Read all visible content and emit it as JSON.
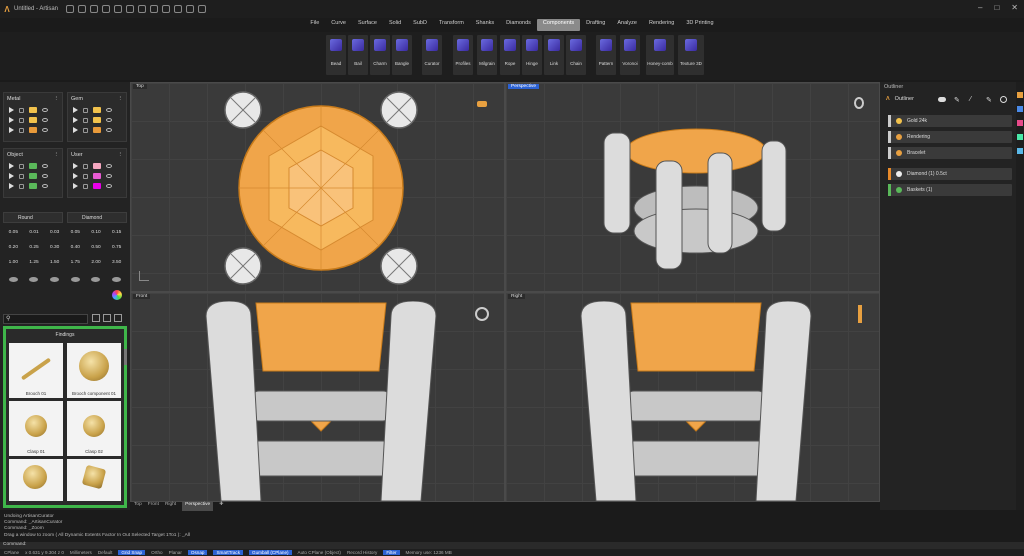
{
  "app": {
    "title": "Untitled - Artisan"
  },
  "menu_tabs": [
    "File",
    "Curve",
    "Surface",
    "Solid",
    "SubD",
    "Transform",
    "Shanks",
    "Diamonds",
    "Components",
    "Drafting",
    "Analyze",
    "Rendering",
    "3D Printing"
  ],
  "active_tab": "Components",
  "ribbon": [
    {
      "label": "Bead"
    },
    {
      "label": "Bail"
    },
    {
      "label": "Charm"
    },
    {
      "label": "Bangle"
    },
    {
      "label": "Curator"
    },
    {
      "label": "Profiles"
    },
    {
      "label": "Milgrain"
    },
    {
      "label": "Rope"
    },
    {
      "label": "Hinge"
    },
    {
      "label": "Link"
    },
    {
      "label": "Chain"
    },
    {
      "label": "Pattern"
    },
    {
      "label": "Voronoi"
    },
    {
      "label": "Honey-comb"
    },
    {
      "label": "Texture 3D"
    }
  ],
  "left": {
    "metal_title": "Metal",
    "gem_title": "Gem",
    "object_title": "Object",
    "user_title": "User",
    "metal_colors": [
      "#f2c24c",
      "#f2c24c",
      "#e89a3a"
    ],
    "gem_colors": [
      "#f2c24c",
      "#f2c24c",
      "#e89a3a"
    ],
    "object_colors": [
      "#5ab85a",
      "#5ab85a",
      "#5ab85a"
    ],
    "user_colors": [
      "#f6a7c0",
      "#e85bd3",
      "#e800e8"
    ],
    "cut_select": "Round",
    "gem_select": "Diamond",
    "sizes": [
      "0.05",
      "0.01",
      "0.03",
      "0.05",
      "0.10",
      "0.15",
      "0.20",
      "0.25",
      "0.30",
      "0.40",
      "0.50",
      "0.75",
      "1.00",
      "1.25",
      "1.50",
      "1.75",
      "2.00",
      "3.50"
    ],
    "library_title": "Findings",
    "cards": [
      {
        "label": "Brooch 01"
      },
      {
        "label": "Brooch component 01"
      },
      {
        "label": "Clasp 01"
      },
      {
        "label": "Clasp 02"
      }
    ]
  },
  "viewports": {
    "top": "Top",
    "perspective": "Perspective",
    "front": "Front",
    "right": "Right"
  },
  "right": {
    "title": "Outliner",
    "outliner_label": "Outliner",
    "items": [
      {
        "label": "Gold 24k",
        "color": "#f2c24c"
      },
      {
        "label": "Rendering",
        "color": "#e8a040"
      },
      {
        "label": "Bracelet",
        "color": "#e8a040"
      }
    ],
    "layers": [
      {
        "label": "Diamond (1) 0.5ct",
        "color": "#e88a2a"
      },
      {
        "label": "Baskets (1)",
        "color": "#5ab85a"
      }
    ]
  },
  "viewport_tabs": [
    "Top",
    "Front",
    "Right",
    "Perspective"
  ],
  "active_viewport_tab": "Perspective",
  "command_history": [
    "Undoing ArtisanCurator",
    "Command: _ArtisanCurator",
    "Command: _Zoom",
    "Drag a window to zoom ( All  Dynamic  Extents  Factor  In  Out  Selected  Target  1To1 ): _All"
  ],
  "command_prompt": "Command:",
  "status": {
    "cplane": "CPlane",
    "coords": "x 0.631  y 9.304  z 0",
    "units": "Millimeters",
    "layer": "Default",
    "grid_snap": "Grid Snap",
    "ortho": "Ortho",
    "planar": "Planar",
    "osnap": "Osnap",
    "smarttrack": "SmartTrack",
    "gumball": "Gumball (CPlane)",
    "auto_cplane": "Auto CPlane (Object)",
    "record_history": "Record History",
    "filter": "Filter",
    "memory": "Memory use: 1236 MB"
  }
}
